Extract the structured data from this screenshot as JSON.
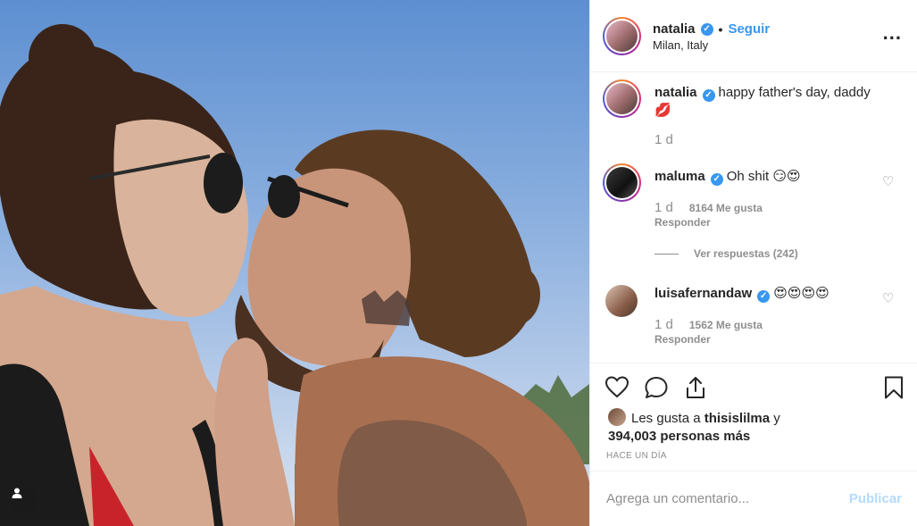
{
  "post": {
    "author": "natalia",
    "follow_label": "Seguir",
    "location": "Milan, Italy",
    "more_label": "..."
  },
  "comments": [
    {
      "user": "natalia",
      "text": "happy father's day, daddy",
      "emoji": "💋",
      "age": "1 d"
    },
    {
      "user": "maluma",
      "text": "Oh shit",
      "emoji": "😏😍",
      "age": "1 d",
      "likes": "8164 Me gusta",
      "reply": "Responder"
    },
    {
      "user": "luisafernandaw",
      "text": "",
      "emoji": "😍😍😍😍",
      "age": "1 d",
      "likes": "1562 Me gusta",
      "reply": "Responder"
    }
  ],
  "view_replies": "Ver respuestas (242)",
  "likes_summary": {
    "line1_prefix": "Les gusta a ",
    "line1_user": "thisislilma",
    "line1_suffix": " y",
    "line2": "394,003 personas más"
  },
  "time_ago": "HACE UN DÍA",
  "add_comment": {
    "placeholder": "Agrega un comentario...",
    "publish_label": "Publicar"
  },
  "icons": {
    "like": "heart-icon",
    "comment": "comment-icon",
    "share": "share-icon",
    "save": "bookmark-icon",
    "tag": "user-tag-icon"
  },
  "colors": {
    "link": "#3897f0",
    "muted": "#8e8e8e",
    "publish_disabled": "#b3dbff"
  }
}
